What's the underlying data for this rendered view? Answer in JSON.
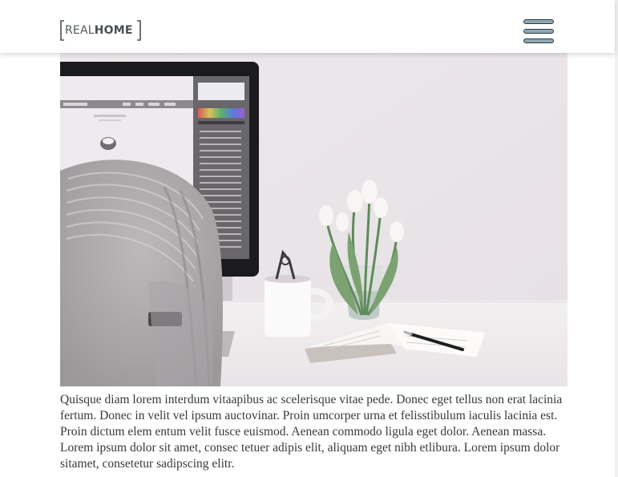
{
  "header": {
    "logo": {
      "text_light": "REAL",
      "text_bold": "HOME"
    },
    "menu_icon": "hamburger-menu-icon"
  },
  "hero": {
    "icon": "desk-photo"
  },
  "content": {
    "paragraph": "Quisque diam lorem interdum vitaapibus ac scelerisque vitae pede. Donec eget tellus non erat lacinia fertum. Donec in velit vel ipsum auctovinar. Proin umcorper urna et felisstibulum iaculis lacinia est. Proin dictum elem entum velit fusce euismod. Aenean commodo ligula eget dolor. Aenean massa. Lorem ipsum dolor sit amet, consec tetuer adipis elit, aliquam eget nibh etlibura. Lorem ipsum dolor sitamet, consetetur sadipscing elitr."
  },
  "colors": {
    "header_bg": "#ffffff",
    "logo_text": "#555a5c",
    "menu_fill": "#8fa6b1",
    "menu_stroke": "#2e3d44",
    "body_text": "#393939"
  }
}
